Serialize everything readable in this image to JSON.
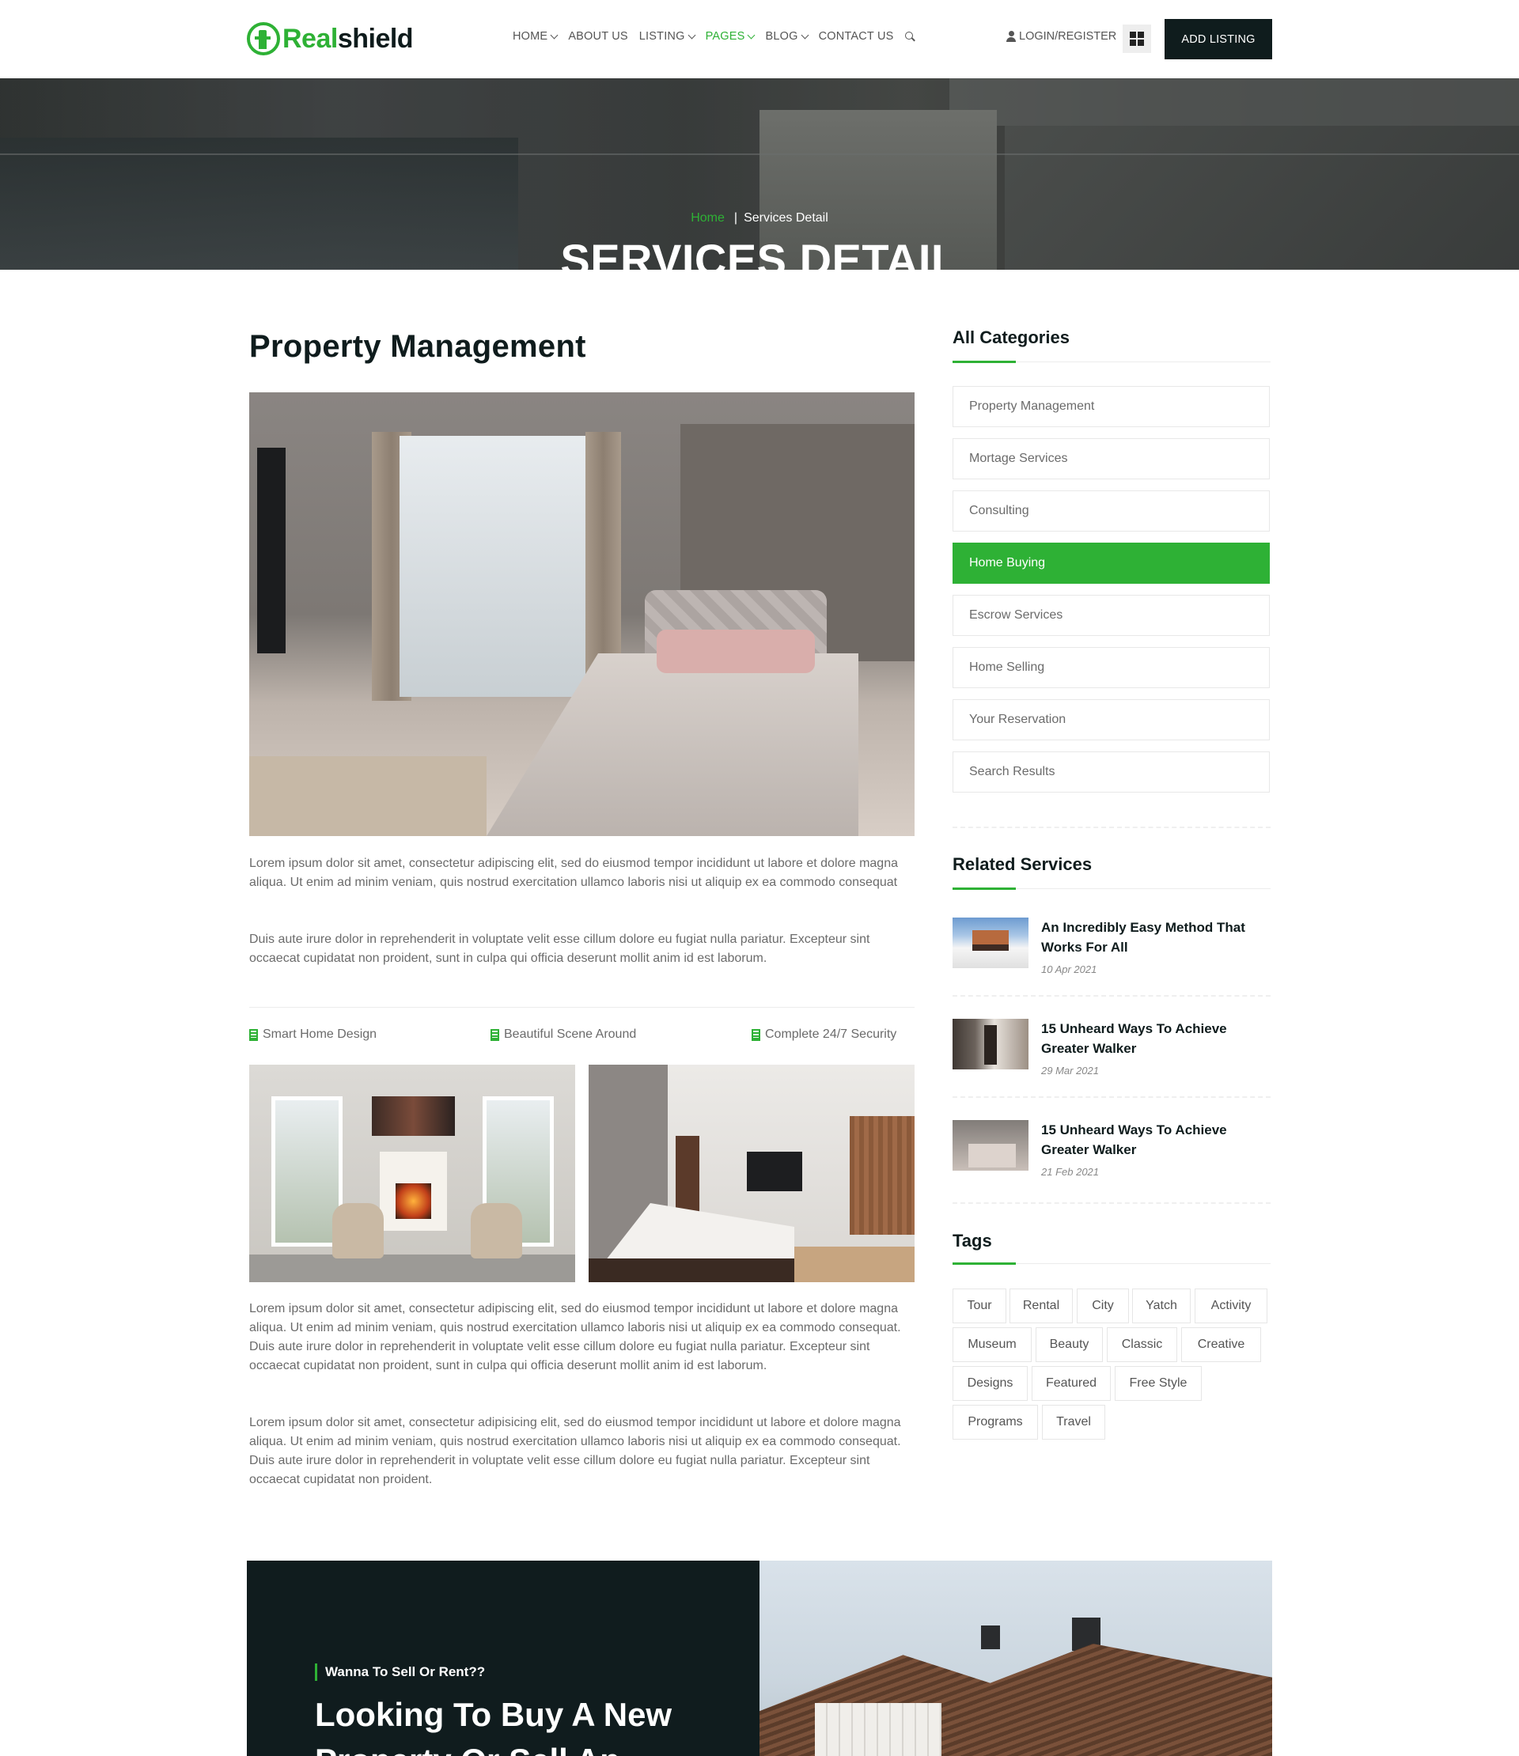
{
  "header": {
    "logo": {
      "part1": "Real",
      "part2": "shield"
    },
    "nav": [
      {
        "label": "HOME",
        "dropdown": true,
        "active": false
      },
      {
        "label": "ABOUT US",
        "dropdown": false,
        "active": false
      },
      {
        "label": "LISTING",
        "dropdown": true,
        "active": false
      },
      {
        "label": "PAGES",
        "dropdown": true,
        "active": true
      },
      {
        "label": "BLOG",
        "dropdown": true,
        "active": false
      },
      {
        "label": "CONTACT US",
        "dropdown": false,
        "active": false
      }
    ],
    "login_label": "LOGIN/REGISTER",
    "add_listing_label": "ADD LISTING"
  },
  "hero": {
    "breadcrumb_home": "Home",
    "breadcrumb_current": "Services Detail",
    "title": "SERVICES DETAIL"
  },
  "main": {
    "title": "Property Management",
    "paragraphs": [
      "Lorem ipsum dolor sit amet, consectetur adipiscing elit, sed do eiusmod tempor incididunt ut labore et dolore magna aliqua. Ut enim ad minim veniam, quis nostrud exercitation ullamco laboris nisi ut aliquip ex ea commodo consequat",
      "Duis aute irure dolor in reprehenderit in voluptate velit esse cillum dolore eu fugiat nulla pariatur. Excepteur sint occaecat cupidatat non proident, sunt in culpa qui officia deserunt mollit anim id est laborum.",
      "Lorem ipsum dolor sit amet, consectetur adipiscing elit, sed do eiusmod tempor incididunt ut labore et dolore magna aliqua. Ut enim ad minim veniam, quis nostrud exercitation ullamco laboris nisi ut aliquip ex ea commodo consequat. Duis aute irure dolor in reprehenderit in voluptate velit esse cillum dolore eu fugiat nulla pariatur. Excepteur sint occaecat cupidatat non proident, sunt in culpa qui officia deserunt mollit anim id est laborum.",
      "Lorem ipsum dolor sit amet, consectetur adipisicing elit, sed do eiusmod tempor incididunt ut labore et dolore magna aliqua. Ut enim ad minim veniam, quis nostrud exercitation ullamco laboris nisi ut aliquip ex ea commodo consequat. Duis aute irure dolor in reprehenderit in voluptate velit esse cillum dolore eu fugiat nulla pariatur. Excepteur sint occaecat cupidatat non proident."
    ],
    "features": [
      "Smart Home Design",
      "Beautiful Scene Around",
      "Complete 24/7 Security"
    ]
  },
  "sidebar": {
    "categories_title": "All Categories",
    "categories": [
      {
        "label": "Property Management",
        "active": false
      },
      {
        "label": "Mortage Services",
        "active": false
      },
      {
        "label": "Consulting",
        "active": false
      },
      {
        "label": "Home Buying",
        "active": true
      },
      {
        "label": "Escrow Services",
        "active": false
      },
      {
        "label": "Home Selling",
        "active": false
      },
      {
        "label": "Your Reservation",
        "active": false
      },
      {
        "label": "Search Results",
        "active": false
      }
    ],
    "related_title": "Related Services",
    "related": [
      {
        "title": "An Incredibly Easy Method That Works For All",
        "date": "10 Apr 2021"
      },
      {
        "title": "15 Unheard Ways To Achieve Greater Walker",
        "date": "29 Mar 2021"
      },
      {
        "title": "15 Unheard Ways To Achieve Greater Walker",
        "date": "21 Feb 2021"
      }
    ],
    "tags_title": "Tags",
    "tags": [
      "Tour",
      "Rental",
      "City",
      "Yatch",
      "Activity",
      "Museum",
      "Beauty",
      "Classic",
      "Creative",
      "Designs",
      "Featured",
      "Free Style",
      "Programs",
      "Travel"
    ]
  },
  "cta": {
    "subtitle": "Wanna To Sell Or Rent??",
    "title": "Looking To Buy A New Property Or Sell An Existing One?"
  },
  "colors": {
    "accent": "#2eb135",
    "dark": "#0f1c1d",
    "text_muted": "#6b6b6b"
  }
}
